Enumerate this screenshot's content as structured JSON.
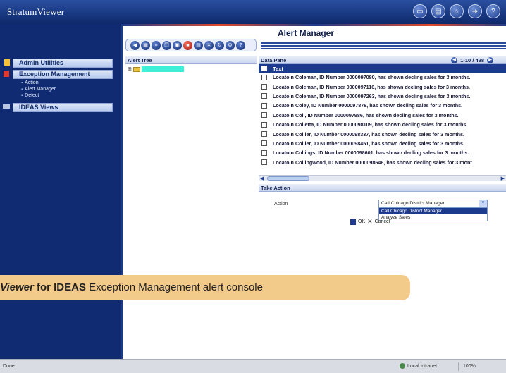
{
  "app": {
    "brand": "StratumViewer"
  },
  "top_icons": [
    "monitor-icon",
    "chart-icon",
    "home-icon",
    "logout-icon",
    "help-icon"
  ],
  "sidebar": {
    "sections": [
      {
        "label": "Admin Utilities",
        "marker_color": "#f3c13a"
      },
      {
        "label": "Exception Management",
        "marker_color": "#e23a2a",
        "items": [
          "Action",
          "Alert Manager",
          "Detect"
        ]
      },
      {
        "label": "IDEAS Views",
        "marker_color": "#b8c4e0"
      }
    ]
  },
  "main": {
    "title": "Alert Manager",
    "alert_tree": {
      "header": "Alert Tree"
    },
    "data_pane": {
      "header": "Data Pane",
      "pager": "1-10 / 498",
      "column": "Text",
      "rows": [
        "Locatoin Coleman, ID Number 0000097080, has shown decling sales for 3 months.",
        "Locatoin Coleman, ID Number 0000097116, has shown decling sales for 3 months.",
        "Locatoin Coleman, ID Number 0000097263, has shown decling sales for 3 months.",
        "Locatoin Coley, ID Number 0000097878, has shown decling sales for 3 months.",
        "Locatoin Coll, ID Number 0000097986, has shown decling sales for 3 months.",
        "Locatoin Colletta, ID Number 0000098109, has shown decling sales for 3 months.",
        "Locatoin Collier, ID Number 0000098337, has shown decling sales for 3 months.",
        "Locatoin Collier, ID Number 0000098451, has shown decling sales for 3 months.",
        "Locatoin Collings, ID Number 0000098601, has shown decling sales for 3 months.",
        "Locatoin Collingwood, ID Number 0000098646, has shown decling sales for 3 mont"
      ]
    },
    "take_action": {
      "header": "Take Action",
      "action_label": "Action",
      "selected": "Call Chicago District Manager",
      "options": [
        "Call Chicago District Manager",
        "Analyze Sales"
      ],
      "ok_label": "OK",
      "cancel_label": "Cancel"
    }
  },
  "caption": {
    "part1": "Viewer",
    "part2": " for IDEAS",
    "part3": " Exception Management alert console"
  },
  "statusbar": {
    "status": "Done",
    "zone": "Local intranet",
    "zoom": "100%"
  }
}
